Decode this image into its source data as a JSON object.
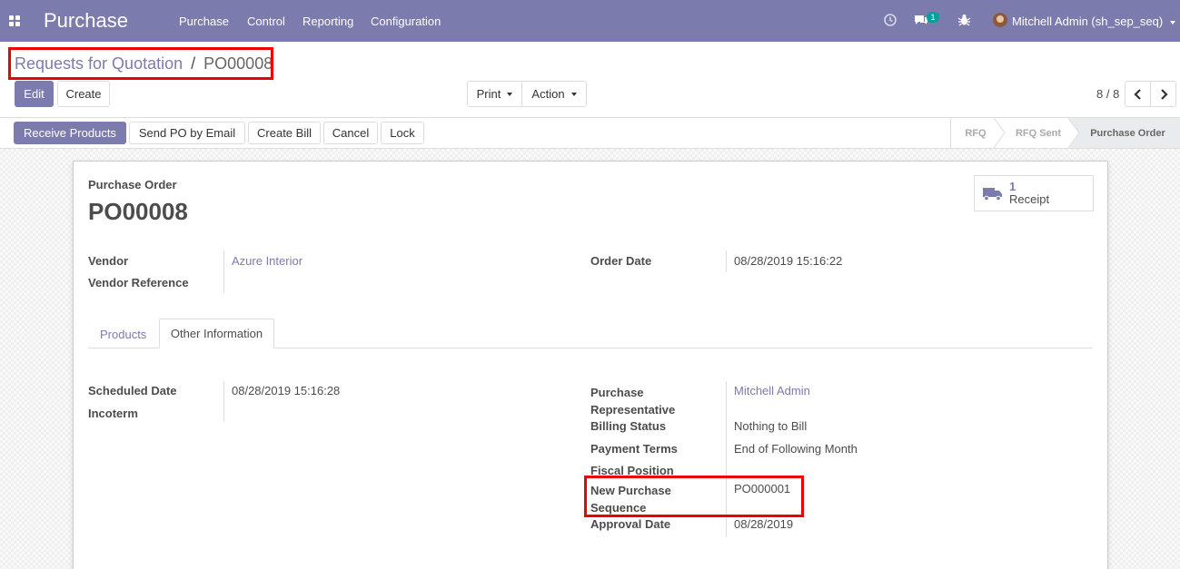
{
  "navbar": {
    "brand": "Purchase",
    "menu": [
      "Purchase",
      "Control",
      "Reporting",
      "Configuration"
    ],
    "message_count": "1",
    "user_name": "Mitchell Admin (sh_sep_seq)"
  },
  "breadcrumb": {
    "parent": "Requests for Quotation",
    "separator": "/",
    "current": "PO00008"
  },
  "buttons": {
    "edit": "Edit",
    "create": "Create",
    "print": "Print",
    "action": "Action"
  },
  "pager": {
    "value": "8 / 8"
  },
  "header_buttons": {
    "receive_products": "Receive Products",
    "send_po_email": "Send PO by Email",
    "create_bill": "Create Bill",
    "cancel": "Cancel",
    "lock": "Lock"
  },
  "statusbar": {
    "stages": [
      "RFQ",
      "RFQ Sent",
      "Purchase Order"
    ],
    "current": "Purchase Order"
  },
  "smart_button": {
    "count": "1",
    "label": "Receipt"
  },
  "form": {
    "heading_label": "Purchase Order",
    "name": "PO00008",
    "vendor_label": "Vendor",
    "vendor_value": "Azure Interior",
    "vendor_ref_label": "Vendor Reference",
    "order_date_label": "Order Date",
    "order_date_value": "08/28/2019 15:16:22"
  },
  "tabs": [
    "Products",
    "Other Information"
  ],
  "other_info": {
    "scheduled_date_label": "Scheduled Date",
    "scheduled_date_value": "08/28/2019 15:16:28",
    "incoterm_label": "Incoterm",
    "purchase_rep_label_1": "Purchase",
    "purchase_rep_label_2": "Representative",
    "purchase_rep_value": "Mitchell Admin",
    "billing_status_label": "Billing Status",
    "billing_status_value": "Nothing to Bill",
    "payment_terms_label": "Payment Terms",
    "payment_terms_value": "End of Following Month",
    "fiscal_position_label": "Fiscal Position",
    "new_seq_label_1": "New Purchase",
    "new_seq_label_2": "Sequence",
    "new_seq_value": "PO000001",
    "approval_date_label": "Approval Date",
    "approval_date_value": "08/28/2019"
  },
  "colors": {
    "brand": "#7c7bad",
    "highlight": "#e00000",
    "badge": "#00a09d"
  }
}
